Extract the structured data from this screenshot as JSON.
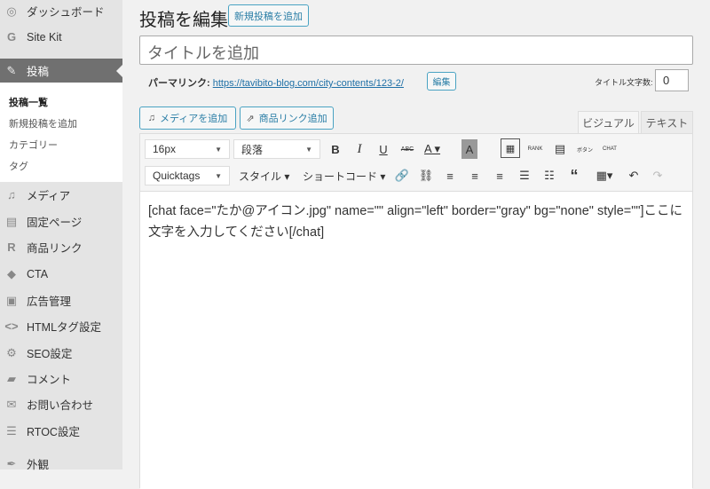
{
  "sidebar": {
    "items": [
      {
        "label": "ダッシュボード",
        "icon": "dashboard-icon",
        "glyph": "◎"
      },
      {
        "label": "Site Kit",
        "icon": "google-icon",
        "glyph": "G"
      },
      {
        "label": "投稿",
        "icon": "posts-icon",
        "glyph": "✎"
      },
      {
        "label": "メディア",
        "icon": "media-icon",
        "glyph": "♫"
      },
      {
        "label": "固定ページ",
        "icon": "pages-icon",
        "glyph": "▤"
      },
      {
        "label": "商品リンク",
        "icon": "product-link-icon",
        "glyph": "R"
      },
      {
        "label": "CTA",
        "icon": "cta-icon",
        "glyph": "◆"
      },
      {
        "label": "広告管理",
        "icon": "ads-icon",
        "glyph": "▣"
      },
      {
        "label": "HTMLタグ設定",
        "icon": "code-icon",
        "glyph": "<>"
      },
      {
        "label": "SEO設定",
        "icon": "gear-icon",
        "glyph": "⚙"
      },
      {
        "label": "コメント",
        "icon": "comment-icon",
        "glyph": "▰"
      },
      {
        "label": "お問い合わせ",
        "icon": "mail-icon",
        "glyph": "✉"
      },
      {
        "label": "RTOC設定",
        "icon": "list-icon",
        "glyph": "☰"
      },
      {
        "label": "外観",
        "icon": "appearance-icon",
        "glyph": "✒"
      }
    ],
    "submenu": [
      "投稿一覧",
      "新規投稿を追加",
      "カテゴリー",
      "タグ"
    ]
  },
  "header": {
    "title": "投稿を編集",
    "add_new": "新規投稿を追加"
  },
  "post": {
    "title_placeholder": "タイトルを追加",
    "permalink_label": "パーマリンク:",
    "permalink_url": "https://tavibito-blog.com/city-contents/123-2/",
    "edit_label": "編集",
    "char_count_label": "タイトル文字数:",
    "char_count": "0"
  },
  "editor": {
    "add_media": "メディアを追加",
    "add_product_link": "商品リンク追加",
    "tab_visual": "ビジュアル",
    "tab_text": "テキスト",
    "font_size": "16px",
    "paragraph": "段落",
    "quicktags": "Quicktags",
    "style": "スタイル ▾",
    "shortcode": "ショートコード ▾",
    "content": "[chat face=\"たか@アイコン.jpg\" name=\"\" align=\"left\" border=\"gray\" bg=\"none\" style=\"\"]ここに文字を入力してください[/chat]"
  }
}
